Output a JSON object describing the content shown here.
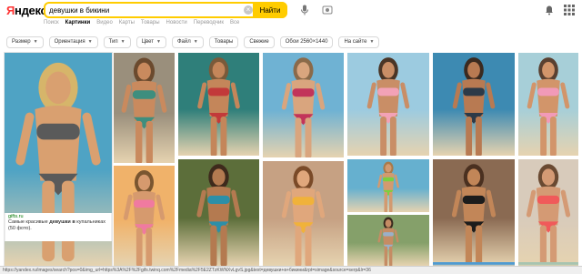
{
  "logo": {
    "first_letter": "Я",
    "rest": "ндекс"
  },
  "search": {
    "query": "девушки в бикини",
    "button_label": "Найти"
  },
  "tabs": [
    {
      "label": "Поиск"
    },
    {
      "label": "Картинки",
      "active": true
    },
    {
      "label": "Видео"
    },
    {
      "label": "Карты"
    },
    {
      "label": "Товары"
    },
    {
      "label": "Новости"
    },
    {
      "label": "Переводчик"
    },
    {
      "label": "Все"
    }
  ],
  "filters": [
    {
      "label": "Размер",
      "caret": true
    },
    {
      "label": "Ориентация",
      "caret": true
    },
    {
      "label": "Тип",
      "caret": true
    },
    {
      "label": "Цвет",
      "caret": true
    },
    {
      "label": "Файл",
      "caret": true
    },
    {
      "label": "Товары",
      "caret": false
    },
    {
      "label": "Свежие",
      "caret": false
    },
    {
      "label": "Обои 2560×1440",
      "caret": false
    },
    {
      "label": "На сайте",
      "caret": true
    }
  ],
  "snippet": {
    "domain": "gifts.ru",
    "description_before": "Самые красивые ",
    "description_bold": "девушки в",
    "description_after": " купальниках (50 фото)."
  },
  "statusbar": {
    "url": "https://yandex.ru/images/search?pos=0&img_url=https%3A%2F%2Fgifs.twinq.com%2Fmedia%2F5E2ZTzKWNXvLgvS.jpg&text=девушки+в+бикини&rpt=simage&source=serp&lr=36"
  },
  "colors": {
    "accent": "#ffcc00",
    "brand_red": "#ff3333",
    "snippet_domain": "#007700"
  },
  "icons": [
    "clear-icon",
    "camera-icon",
    "microphone-icon",
    "upload-icon",
    "bell-icon",
    "apps-grid-icon"
  ],
  "images": [
    {
      "bg": "#4fa3c4",
      "skin": "#d9a070",
      "suit": "#5a5a5a",
      "hair": "#d6b56a"
    },
    {
      "bg": "#9a8f7c",
      "skin": "#c98a5e",
      "suit": "#3e8e7e",
      "hair": "#6b4a2e"
    },
    {
      "bg": "#2f7f7a",
      "skin": "#c4865a",
      "suit": "#c23a3a",
      "hair": "#7a5a3a"
    },
    {
      "bg": "#6fb2d3",
      "skin": "#d9a57e",
      "suit": "#c2345a",
      "hair": "#8a6a4a"
    },
    {
      "bg": "#9ccbe0",
      "skin": "#c98e66",
      "suit": "#f2a2b6",
      "hair": "#4a3526"
    },
    {
      "bg": "#3d8ab2",
      "skin": "#b87a52",
      "suit": "#2c3a48",
      "hair": "#3a2a20"
    },
    {
      "bg": "#a7cfd8",
      "skin": "#d2956a",
      "suit": "#f19ab8",
      "hair": "#5a4030"
    },
    {
      "bg": "#f0b26a",
      "skin": "#d69a6e",
      "suit": "#f07aa0",
      "hair": "#7a5630"
    },
    {
      "bg": "#5c6e3a",
      "skin": "#b47a50",
      "suit": "#2c8fa8",
      "hair": "#3e2a1c"
    },
    {
      "bg": "#c6a183",
      "skin": "#e0a77c",
      "suit": "#f0b23a",
      "hair": "#7a4a28"
    },
    {
      "bg": "#66b0cf",
      "skin": "#d29a70",
      "suit": "#7ad040",
      "hair": "#a87a4a"
    },
    {
      "bg": "#8a6a52",
      "skin": "#c28658",
      "suit": "#1c1c1c",
      "hair": "#4a3020"
    },
    {
      "bg": "#d8cbbb",
      "skin": "#d49a74",
      "suit": "#f05a5a",
      "hair": "#6a4a32"
    },
    {
      "bg": "#85a06a",
      "skin": "#c58c64",
      "suit": "#9ab0c8",
      "hair": "#3a2a1e"
    },
    {
      "bg": "#4f9bd1",
      "skin": "#c98a62",
      "suit": "#34b86a",
      "hair": "#2e2018"
    },
    {
      "bg": "#a7c4b0",
      "skin": "#d1986e",
      "suit": "#e8a2b0",
      "hair": "#5a3a26"
    }
  ]
}
